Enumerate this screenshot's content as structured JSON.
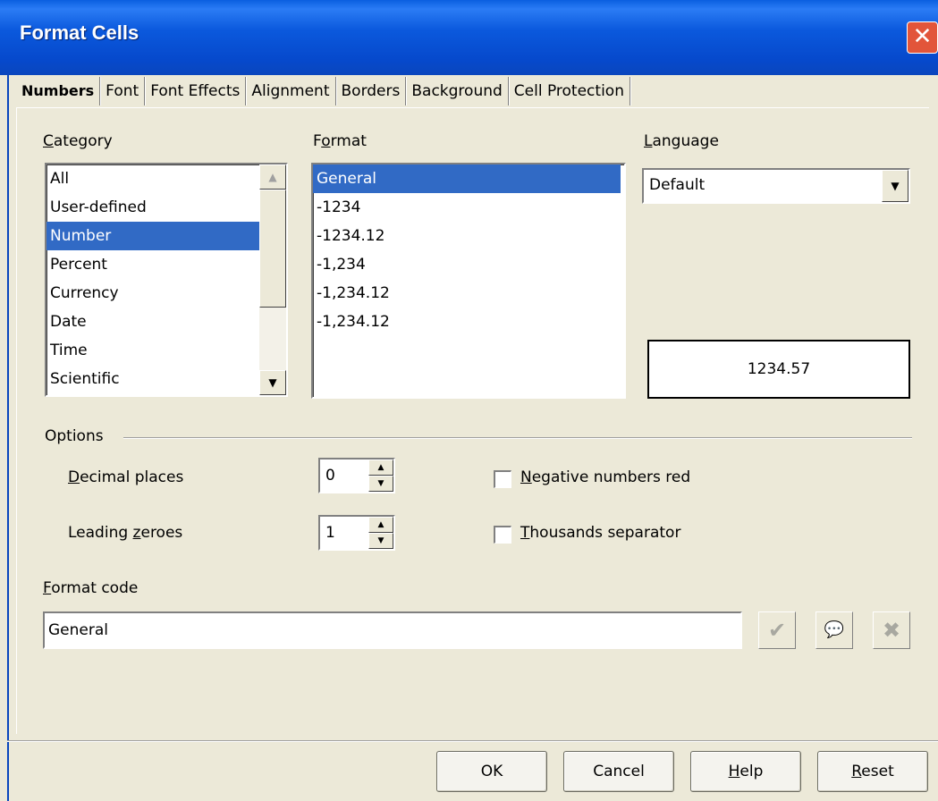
{
  "window": {
    "title": "Format Cells",
    "close_glyph": "✕"
  },
  "tabs": [
    {
      "label": "Numbers",
      "active": true
    },
    {
      "label": "Font"
    },
    {
      "label": "Font Effects"
    },
    {
      "label": "Alignment"
    },
    {
      "label": "Borders"
    },
    {
      "label": "Background"
    },
    {
      "label": "Cell Protection"
    }
  ],
  "category": {
    "label_first": "C",
    "label_rest": "ategory",
    "items": [
      "All",
      "User-defined",
      "Number",
      "Percent",
      "Currency",
      "Date",
      "Time",
      "Scientific"
    ],
    "selected": "Number"
  },
  "format": {
    "label_first": "F",
    "label_mid": "o",
    "label_rest": "rmat",
    "items": [
      "General",
      "-1234",
      "-1234.12",
      "-1,234",
      "-1,234.12",
      "-1,234.12"
    ],
    "selected": "General"
  },
  "language": {
    "label_first": "L",
    "label_rest": "anguage",
    "value": "Default"
  },
  "preview": {
    "value": "1234.57"
  },
  "options": {
    "title": "Options",
    "decimal_places": {
      "label_first": "D",
      "label_rest": "ecimal places",
      "value": "0"
    },
    "leading_zeroes": {
      "label_pre": "Leading ",
      "label_u": "z",
      "label_rest": "eroes",
      "value": "1"
    },
    "negative_red": {
      "label_first": "N",
      "label_rest": "egative numbers red",
      "checked": false
    },
    "thousands_sep": {
      "label_first": "T",
      "label_rest": "housands separator",
      "checked": false
    }
  },
  "format_code": {
    "label_first": "F",
    "label_rest": "ormat code",
    "value": "General"
  },
  "icons": {
    "accept": "✔",
    "comment": "💬",
    "delete": "✖"
  },
  "buttons": {
    "ok": "OK",
    "cancel": "Cancel",
    "help_u": "H",
    "help_rest": "elp",
    "reset_u": "R",
    "reset_rest": "eset"
  }
}
